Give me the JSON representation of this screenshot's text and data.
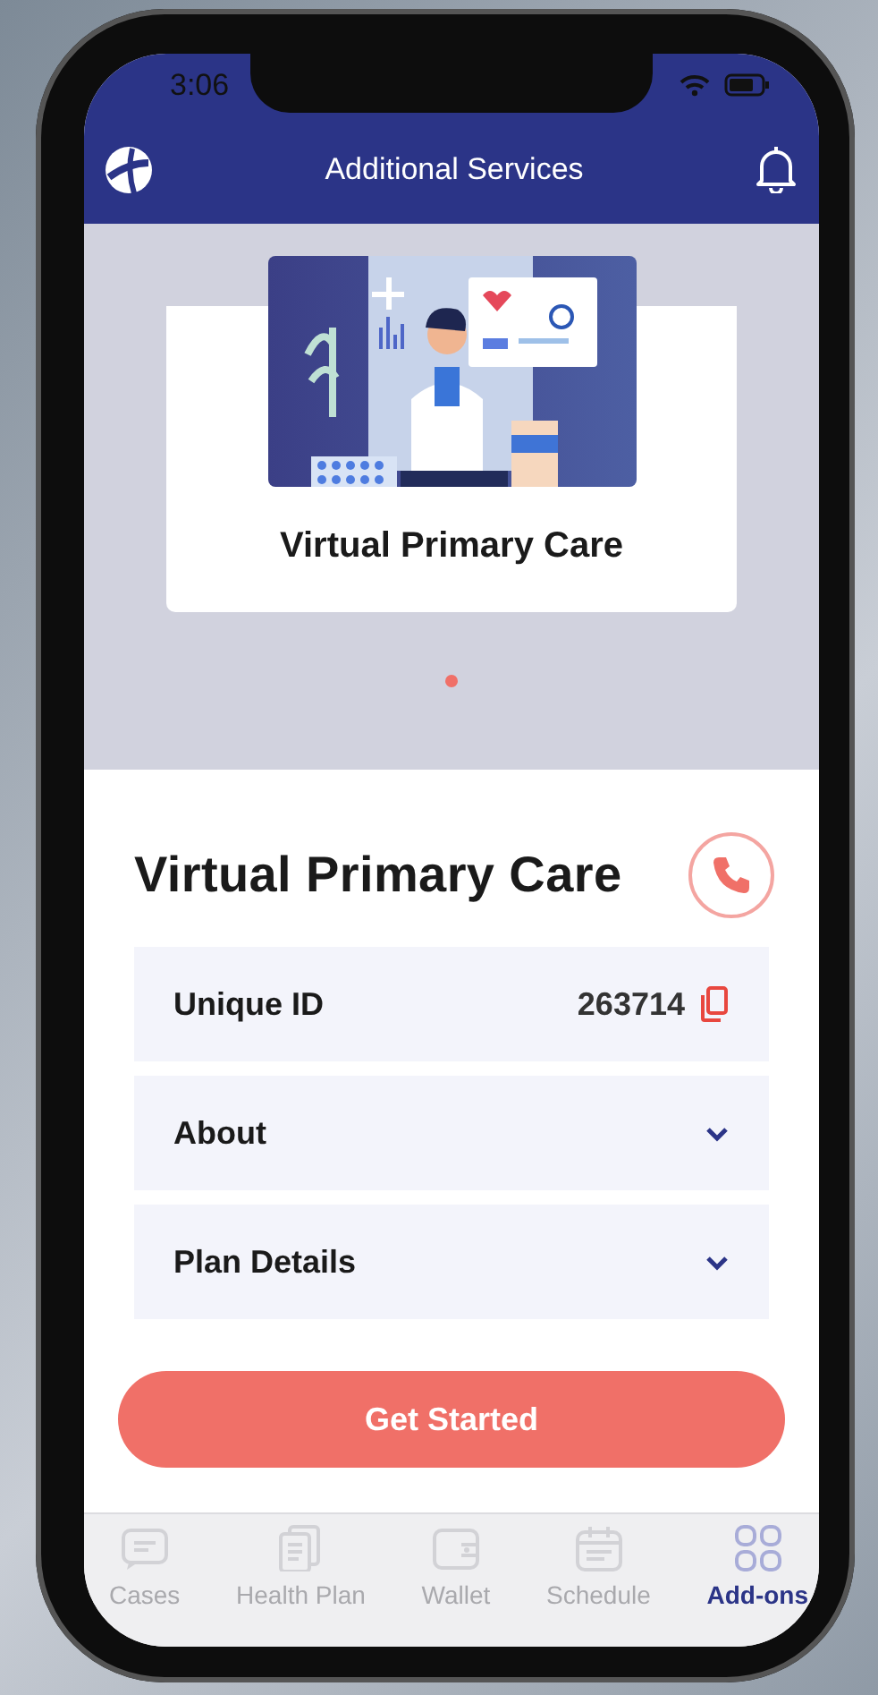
{
  "status_bar": {
    "time": "3:06"
  },
  "header": {
    "title": "Additional Services"
  },
  "carousel": {
    "slides": [
      {
        "caption": "Virtual Primary Care",
        "selected": true
      }
    ]
  },
  "service": {
    "title": "Virtual Primary Care",
    "rows": [
      {
        "kind": "value",
        "label": "Unique ID",
        "value": "263714"
      },
      {
        "kind": "expandable",
        "label": "About",
        "expanded": false
      },
      {
        "kind": "expandable",
        "label": "Plan Details",
        "expanded": false
      }
    ]
  },
  "primary_button": "Get Started",
  "tab_bar": [
    {
      "kind": "cases",
      "label": "Cases",
      "selected": false
    },
    {
      "kind": "plan",
      "label": "Health Plan",
      "selected": false
    },
    {
      "kind": "wallet",
      "label": "Wallet",
      "selected": false
    },
    {
      "kind": "schedule",
      "label": "Schedule",
      "selected": false
    },
    {
      "kind": "addons",
      "label": "Add-ons",
      "selected": true
    }
  ]
}
